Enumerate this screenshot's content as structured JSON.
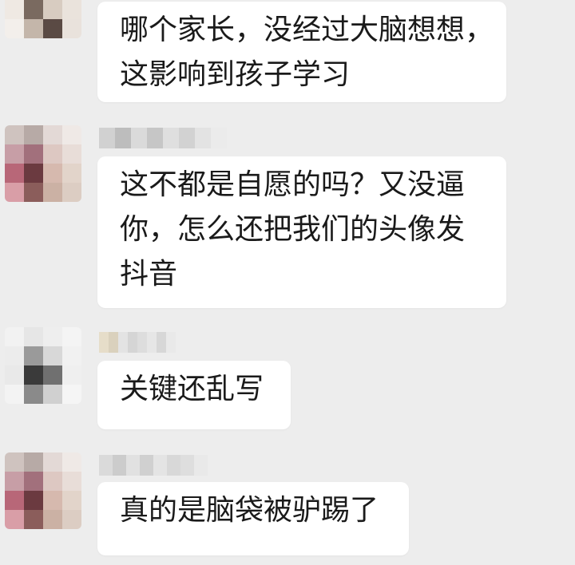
{
  "messages": [
    {
      "lines": [
        "哪个家长，没经过大脑想想，",
        "这影响到孩子学习"
      ]
    },
    {
      "lines": [
        "这不都是自愿的吗？又没逼",
        "你，怎么还把我们的头像发",
        "抖音"
      ]
    },
    {
      "lines": [
        "关键还乱写"
      ]
    },
    {
      "lines": [
        "真的是脑袋被驴踢了"
      ]
    }
  ],
  "colors": {
    "background": "#ededed",
    "bubble": "#ffffff",
    "text": "#1a1a1a"
  }
}
